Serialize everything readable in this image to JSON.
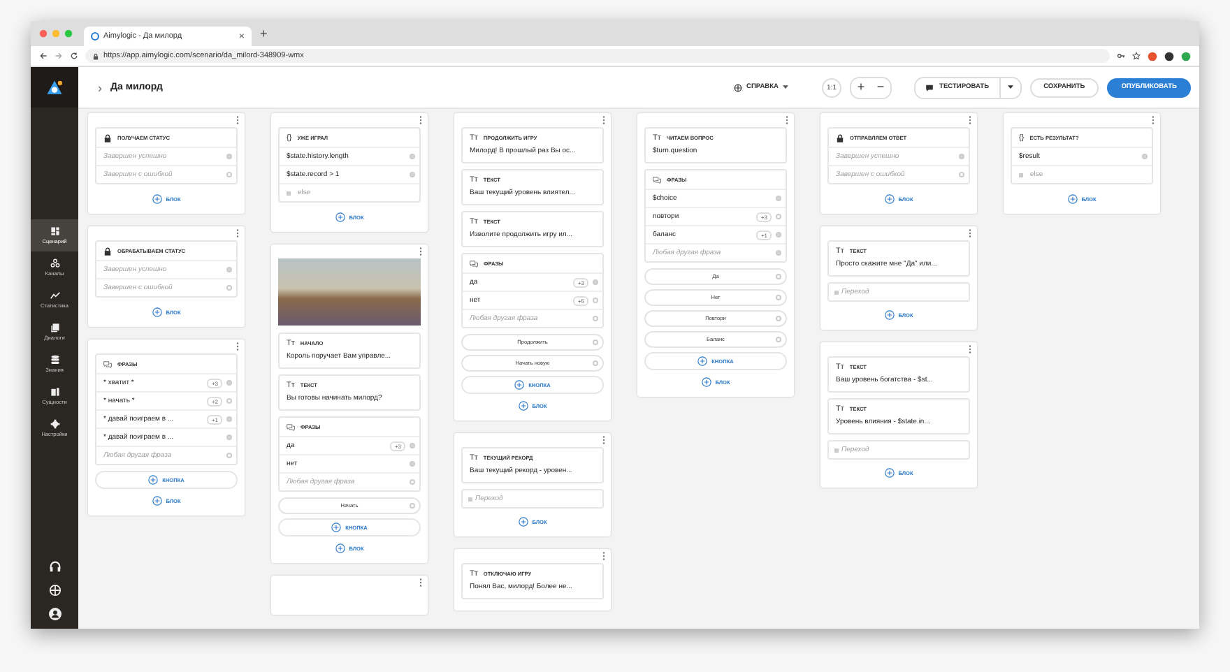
{
  "browser": {
    "tab_title": "Aimylogic - Да милорд",
    "tab_close": "×",
    "new_tab": "+",
    "url": "https://app.aimylogic.com/scenario/da_milord-348909-wmx"
  },
  "sidebar": {
    "items": [
      {
        "label": "Сценарий",
        "selected": true
      },
      {
        "label": "Каналы",
        "selected": false
      },
      {
        "label": "Статистика",
        "selected": false
      },
      {
        "label": "Диалоги",
        "selected": false
      },
      {
        "label": "Знания",
        "selected": false
      },
      {
        "label": "Сущности",
        "selected": false
      },
      {
        "label": "Настройки",
        "selected": false
      }
    ]
  },
  "topbar": {
    "breadcrumb_arrow": "›",
    "title": "Да милорд",
    "help": "СПРАВКА",
    "zoom_reset": "1:1",
    "zoom_in": "+",
    "zoom_out": "−",
    "test": "ТЕСТИРОВАТЬ",
    "save": "СОХРАНИТЬ",
    "publish": "ОПУБЛИКОВАТЬ"
  },
  "canvas": {
    "columns": [
      {
        "cards": [
          {
            "blocks": [
              {
                "kind": "status",
                "title": "ПОЛУЧАЕМ СТАТУС",
                "rows": [
                  {
                    "kind": "fallback",
                    "text": "Завершен успешно",
                    "connected": true
                  },
                  {
                    "kind": "fallback",
                    "text": "Завершен с ошибкой",
                    "connected": false
                  }
                ]
              },
              {
                "kind": "add",
                "label": "БЛОК",
                "framed": false
              }
            ]
          },
          {
            "blocks": [
              {
                "kind": "status",
                "title": "ОБРАБАТЫВАЕМ СТАТУС",
                "rows": [
                  {
                    "kind": "fallback",
                    "text": "Завершен успешно",
                    "connected": true
                  },
                  {
                    "kind": "fallback",
                    "text": "Завершен с ошибкой",
                    "connected": false
                  }
                ]
              },
              {
                "kind": "add",
                "label": "БЛОК",
                "framed": false
              }
            ]
          },
          {
            "blocks": [
              {
                "kind": "phrases",
                "title": "ФРАЗЫ",
                "rows": [
                  {
                    "kind": "entry",
                    "text": "* хватит *",
                    "badge": "+3",
                    "connected": true
                  },
                  {
                    "kind": "entry",
                    "text": "* начать *",
                    "badge": "+2",
                    "connected": false
                  },
                  {
                    "kind": "entry",
                    "text": "* давай поиграем в ...",
                    "badge": "+1",
                    "connected": true
                  },
                  {
                    "kind": "entry",
                    "text": "* давай поиграем в ...",
                    "connected": true
                  },
                  {
                    "kind": "fallback",
                    "text": "Любая другая фраза",
                    "connected": false
                  }
                ]
              },
              {
                "kind": "add",
                "label": "КНОПКА",
                "framed": true
              },
              {
                "kind": "add",
                "label": "БЛОК",
                "framed": false
              }
            ]
          }
        ]
      },
      {
        "cards": [
          {
            "blocks": [
              {
                "kind": "condition",
                "glyph": "{}",
                "title": "УЖЕ ИГРАЛ",
                "rows": [
                  {
                    "kind": "entry",
                    "text": "$state.history.length",
                    "connected": true
                  },
                  {
                    "kind": "entry",
                    "text": "$state.record > 1",
                    "connected": true
                  },
                  {
                    "kind": "else",
                    "text": "else"
                  }
                ]
              },
              {
                "kind": "add",
                "label": "БЛОК",
                "framed": false
              }
            ]
          },
          {
            "blocks": [
              {
                "kind": "image"
              },
              {
                "kind": "text",
                "glyph": "Tт",
                "title": "НАЧАЛО",
                "text": "Король поручает Вам управле..."
              },
              {
                "kind": "text",
                "glyph": "Tт",
                "title": "ТЕКСТ",
                "text": "Вы готовы начинать милорд?"
              },
              {
                "kind": "phrases",
                "title": "ФРАЗЫ",
                "rows": [
                  {
                    "kind": "entry",
                    "text": "да",
                    "badge": "+3",
                    "connected": true
                  },
                  {
                    "kind": "entry",
                    "text": "нет",
                    "connected": true
                  },
                  {
                    "kind": "fallback",
                    "text": "Любая другая фраза",
                    "connected": false
                  }
                ]
              },
              {
                "kind": "button",
                "label": "Начать",
                "connected": false
              },
              {
                "kind": "add",
                "label": "КНОПКА",
                "framed": true
              },
              {
                "kind": "add",
                "label": "БЛОК",
                "framed": false
              }
            ]
          },
          {
            "menu": true
          }
        ]
      },
      {
        "cards": [
          {
            "blocks": [
              {
                "kind": "text",
                "glyph": "Tт",
                "title": "ПРОДОЛЖИТЬ ИГРУ",
                "text": "Милорд! В прошлый раз Вы ос..."
              },
              {
                "kind": "text",
                "glyph": "Tт",
                "title": "ТЕКСТ",
                "text": "Ваш текущий уровень влиятел..."
              },
              {
                "kind": "text",
                "glyph": "Tт",
                "title": "ТЕКСТ",
                "text": "Изволите продолжить игру ил..."
              },
              {
                "kind": "phrases",
                "title": "ФРАЗЫ",
                "rows": [
                  {
                    "kind": "entry",
                    "text": "да",
                    "badge": "+3",
                    "connected": true
                  },
                  {
                    "kind": "entry",
                    "text": "нет",
                    "badge": "+5",
                    "connected": false
                  },
                  {
                    "kind": "fallback",
                    "text": "Любая другая фраза",
                    "connected": false
                  }
                ]
              },
              {
                "kind": "button",
                "label": "Продолжить",
                "connected": false
              },
              {
                "kind": "button",
                "label": "Начать новую",
                "connected": false
              },
              {
                "kind": "add",
                "label": "КНОПКА",
                "framed": true
              },
              {
                "kind": "add",
                "label": "БЛОК",
                "framed": false
              }
            ]
          },
          {
            "blocks": [
              {
                "kind": "text",
                "glyph": "Tт",
                "title": "ТЕКУЩИЙ РЕКОРД",
                "text": "Ваш текущий рекорд - уровен..."
              },
              {
                "kind": "transition",
                "placeholder": "Переход"
              },
              {
                "kind": "add",
                "label": "БЛОК",
                "framed": false
              }
            ]
          },
          {
            "blocks": [
              {
                "kind": "text",
                "glyph": "Tт",
                "title": "ОТКЛЮЧАЮ ИГРУ",
                "text": "Понял Вас, милорд! Более не..."
              }
            ]
          }
        ]
      },
      {
        "cards": [
          {
            "blocks": [
              {
                "kind": "text",
                "glyph": "Tт",
                "title": "ЧИТАЕМ ВОПРОС",
                "text": "$turn.question"
              },
              {
                "kind": "phrases",
                "title": "ФРАЗЫ",
                "rows": [
                  {
                    "kind": "entry",
                    "text": "$choice",
                    "connected": true
                  },
                  {
                    "kind": "entry",
                    "text": "повтори",
                    "badge": "+3",
                    "connected": false
                  },
                  {
                    "kind": "entry",
                    "text": "баланс",
                    "badge": "+1",
                    "connected": true
                  },
                  {
                    "kind": "fallback",
                    "text": "Любая другая фраза",
                    "connected": true
                  }
                ]
              },
              {
                "kind": "button",
                "label": "Да",
                "connected": false
              },
              {
                "kind": "button",
                "label": "Нет",
                "connected": false
              },
              {
                "kind": "button",
                "label": "Повтори",
                "connected": false
              },
              {
                "kind": "button",
                "label": "Баланс",
                "connected": false
              },
              {
                "kind": "add",
                "label": "КНОПКА",
                "framed": true
              },
              {
                "kind": "add",
                "label": "БЛОК",
                "framed": false
              }
            ]
          }
        ]
      },
      {
        "cards": [
          {
            "blocks": [
              {
                "kind": "status",
                "title": "ОТПРАВЛЯЕМ ОТВЕТ",
                "rows": [
                  {
                    "kind": "fallback",
                    "text": "Завершен успешно",
                    "connected": true
                  },
                  {
                    "kind": "fallback",
                    "text": "Завершен с ошибкой",
                    "connected": false
                  }
                ]
              },
              {
                "kind": "add",
                "label": "БЛОК",
                "framed": false
              }
            ]
          },
          {
            "blocks": [
              {
                "kind": "text",
                "glyph": "Tт",
                "title": "ТЕКСТ",
                "text": "Просто скажите мне \"Да\" или..."
              },
              {
                "kind": "transition",
                "placeholder": "Переход"
              },
              {
                "kind": "add",
                "label": "БЛОК",
                "framed": false
              }
            ]
          },
          {
            "blocks": [
              {
                "kind": "text",
                "glyph": "Tт",
                "title": "ТЕКСТ",
                "text": "Ваш уровень богатства - $st..."
              },
              {
                "kind": "text",
                "glyph": "Tт",
                "title": "ТЕКСТ",
                "text": "Уровень влияния - $state.in..."
              },
              {
                "kind": "transition",
                "placeholder": "Переход"
              },
              {
                "kind": "add",
                "label": "БЛОК",
                "framed": false
              }
            ]
          }
        ]
      },
      {
        "cards": [
          {
            "blocks": [
              {
                "kind": "condition",
                "glyph": "{}",
                "title": "ЕСТЬ РЕЗУЛЬТАТ?",
                "rows": [
                  {
                    "kind": "entry",
                    "text": "$result",
                    "connected": true
                  },
                  {
                    "kind": "else",
                    "text": "else"
                  }
                ]
              },
              {
                "kind": "add",
                "label": "БЛОК",
                "framed": false
              }
            ]
          }
        ]
      }
    ]
  }
}
